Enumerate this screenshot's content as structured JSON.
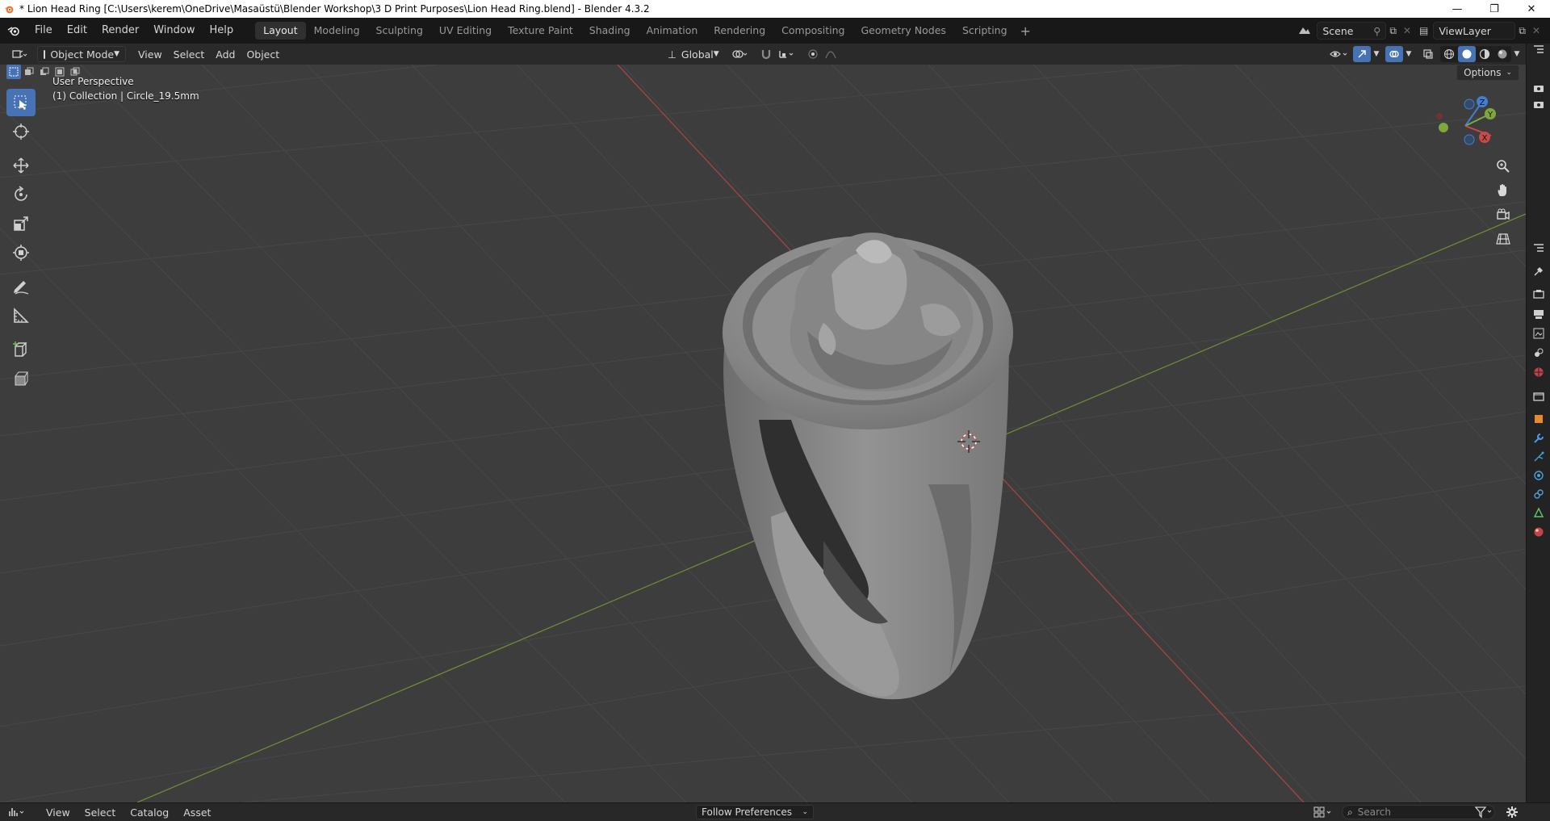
{
  "window": {
    "title": "* Lion Head Ring [C:\\Users\\kerem\\OneDrive\\Masaüstü\\Blender Workshop\\3 D Print Purposes\\Lion Head Ring.blend] - Blender 4.3.2",
    "minimize": "—",
    "restore": "❐",
    "close": "✕"
  },
  "menu": [
    "File",
    "Edit",
    "Render",
    "Window",
    "Help"
  ],
  "workspaces": [
    "Layout",
    "Modeling",
    "Sculpting",
    "UV Editing",
    "Texture Paint",
    "Shading",
    "Animation",
    "Rendering",
    "Compositing",
    "Geometry Nodes",
    "Scripting"
  ],
  "active_workspace": "Layout",
  "scene": {
    "value": "Scene"
  },
  "view_layer": {
    "value": "ViewLayer"
  },
  "viewport_header": {
    "mode": "Object Mode",
    "menus": [
      "View",
      "Select",
      "Add",
      "Object"
    ],
    "orientation": "Global"
  },
  "viewport": {
    "perspective": "User Perspective",
    "collection": "(1) Collection | Circle_19.5mm",
    "options": "Options"
  },
  "gizmo": {
    "z": "Z",
    "y": "Y",
    "x": "X"
  },
  "bottom": {
    "menus": [
      "View",
      "Select",
      "Catalog",
      "Asset"
    ],
    "follow_preferences": "Follow Preferences",
    "search_placeholder": "Search"
  },
  "colors": {
    "active_tool": "#4772b3",
    "x_axis": "#c84a4a",
    "y_axis": "#7fa83c",
    "z_axis": "#3f7fd6"
  }
}
